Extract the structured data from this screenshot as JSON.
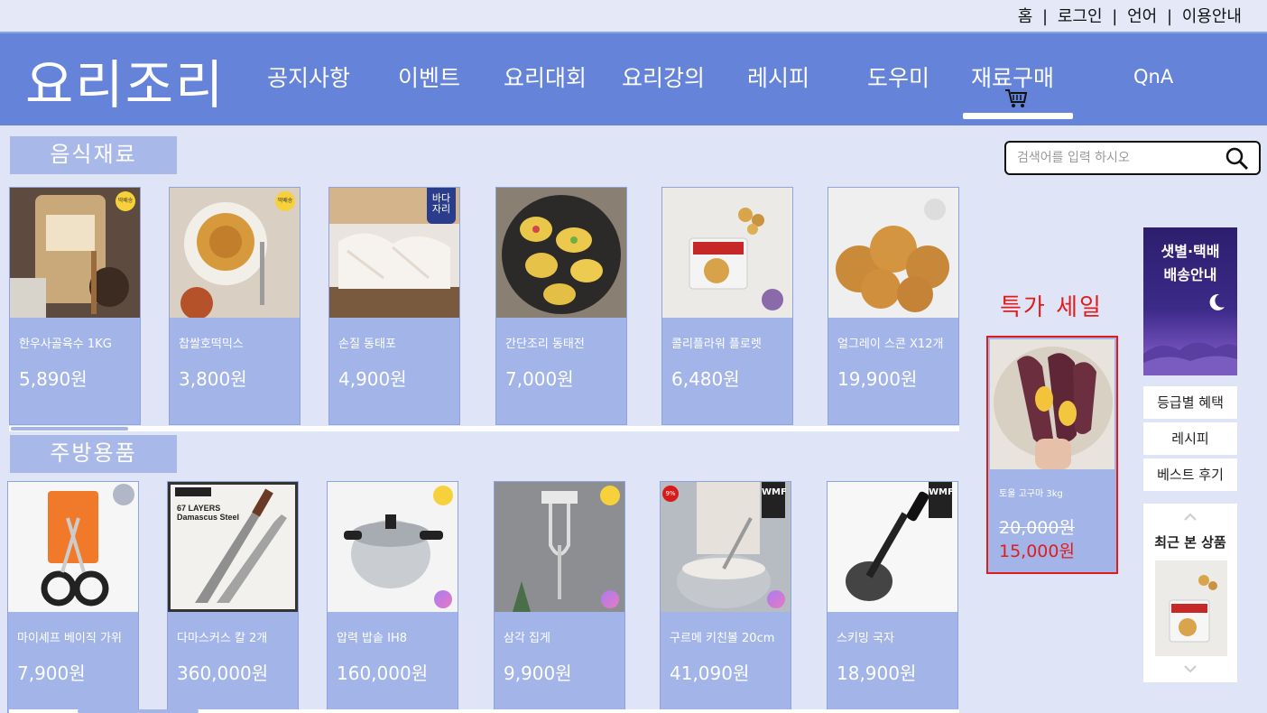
{
  "top_links": [
    "홈",
    "로그인",
    "언어",
    "이용안내"
  ],
  "top_separator": "|",
  "logo": "요리조리",
  "nav": [
    "공지사항",
    "이벤트",
    "요리대회",
    "요리강의",
    "레시피",
    "도우미",
    "재료구매",
    "QnA"
  ],
  "sections": {
    "food": {
      "label": "음식재료",
      "products": [
        {
          "name": "한우사골육수 1KG",
          "price": "5,890원"
        },
        {
          "name": "찹쌀호떡믹스",
          "price": "3,800원"
        },
        {
          "name": "손질 동태포",
          "price": "4,900원"
        },
        {
          "name": "간단조리 동태전",
          "price": "7,000원"
        },
        {
          "name": "콜리플라워 플로렛",
          "price": "6,480원"
        },
        {
          "name": "얼그레이 스콘 X12개",
          "price": "19,900원"
        }
      ]
    },
    "kitchen": {
      "label": "주방용품",
      "products": [
        {
          "name": "마이셰프 베이직 가위",
          "price": "7,900원"
        },
        {
          "name": "다마스커스 칼 2개",
          "price": "360,000원"
        },
        {
          "name": "압력 밥솥 IH8",
          "price": "160,000원"
        },
        {
          "name": "삼각 집게",
          "price": "9,900원"
        },
        {
          "name": "구르메 키친볼 20cm",
          "price": "41,090원"
        },
        {
          "name": "스키밍 국자",
          "price": "18,900원"
        }
      ]
    }
  },
  "search": {
    "placeholder": "검색어를 입력 하시오"
  },
  "sale": {
    "title": "특가 세일",
    "product": {
      "name": "토울 고구마 3kg",
      "old_price": "20,000원",
      "new_price": "15,000원"
    }
  },
  "sidebar": {
    "banner": [
      "샛별·택배",
      "배송안내"
    ],
    "menu": [
      "등급별 혜택",
      "레시피",
      "베스트 후기"
    ],
    "recent_title": "최근 본 상품"
  },
  "badges": {
    "food_0": "딱배송",
    "food_1": "딱배송",
    "food_2": "바다\n자리",
    "kitchen_4_pct": "9%"
  },
  "colors": {
    "header": "#6583d9",
    "card": "#a3b4e8",
    "sale": "#e21c1c",
    "background": "#dfe5f7"
  }
}
